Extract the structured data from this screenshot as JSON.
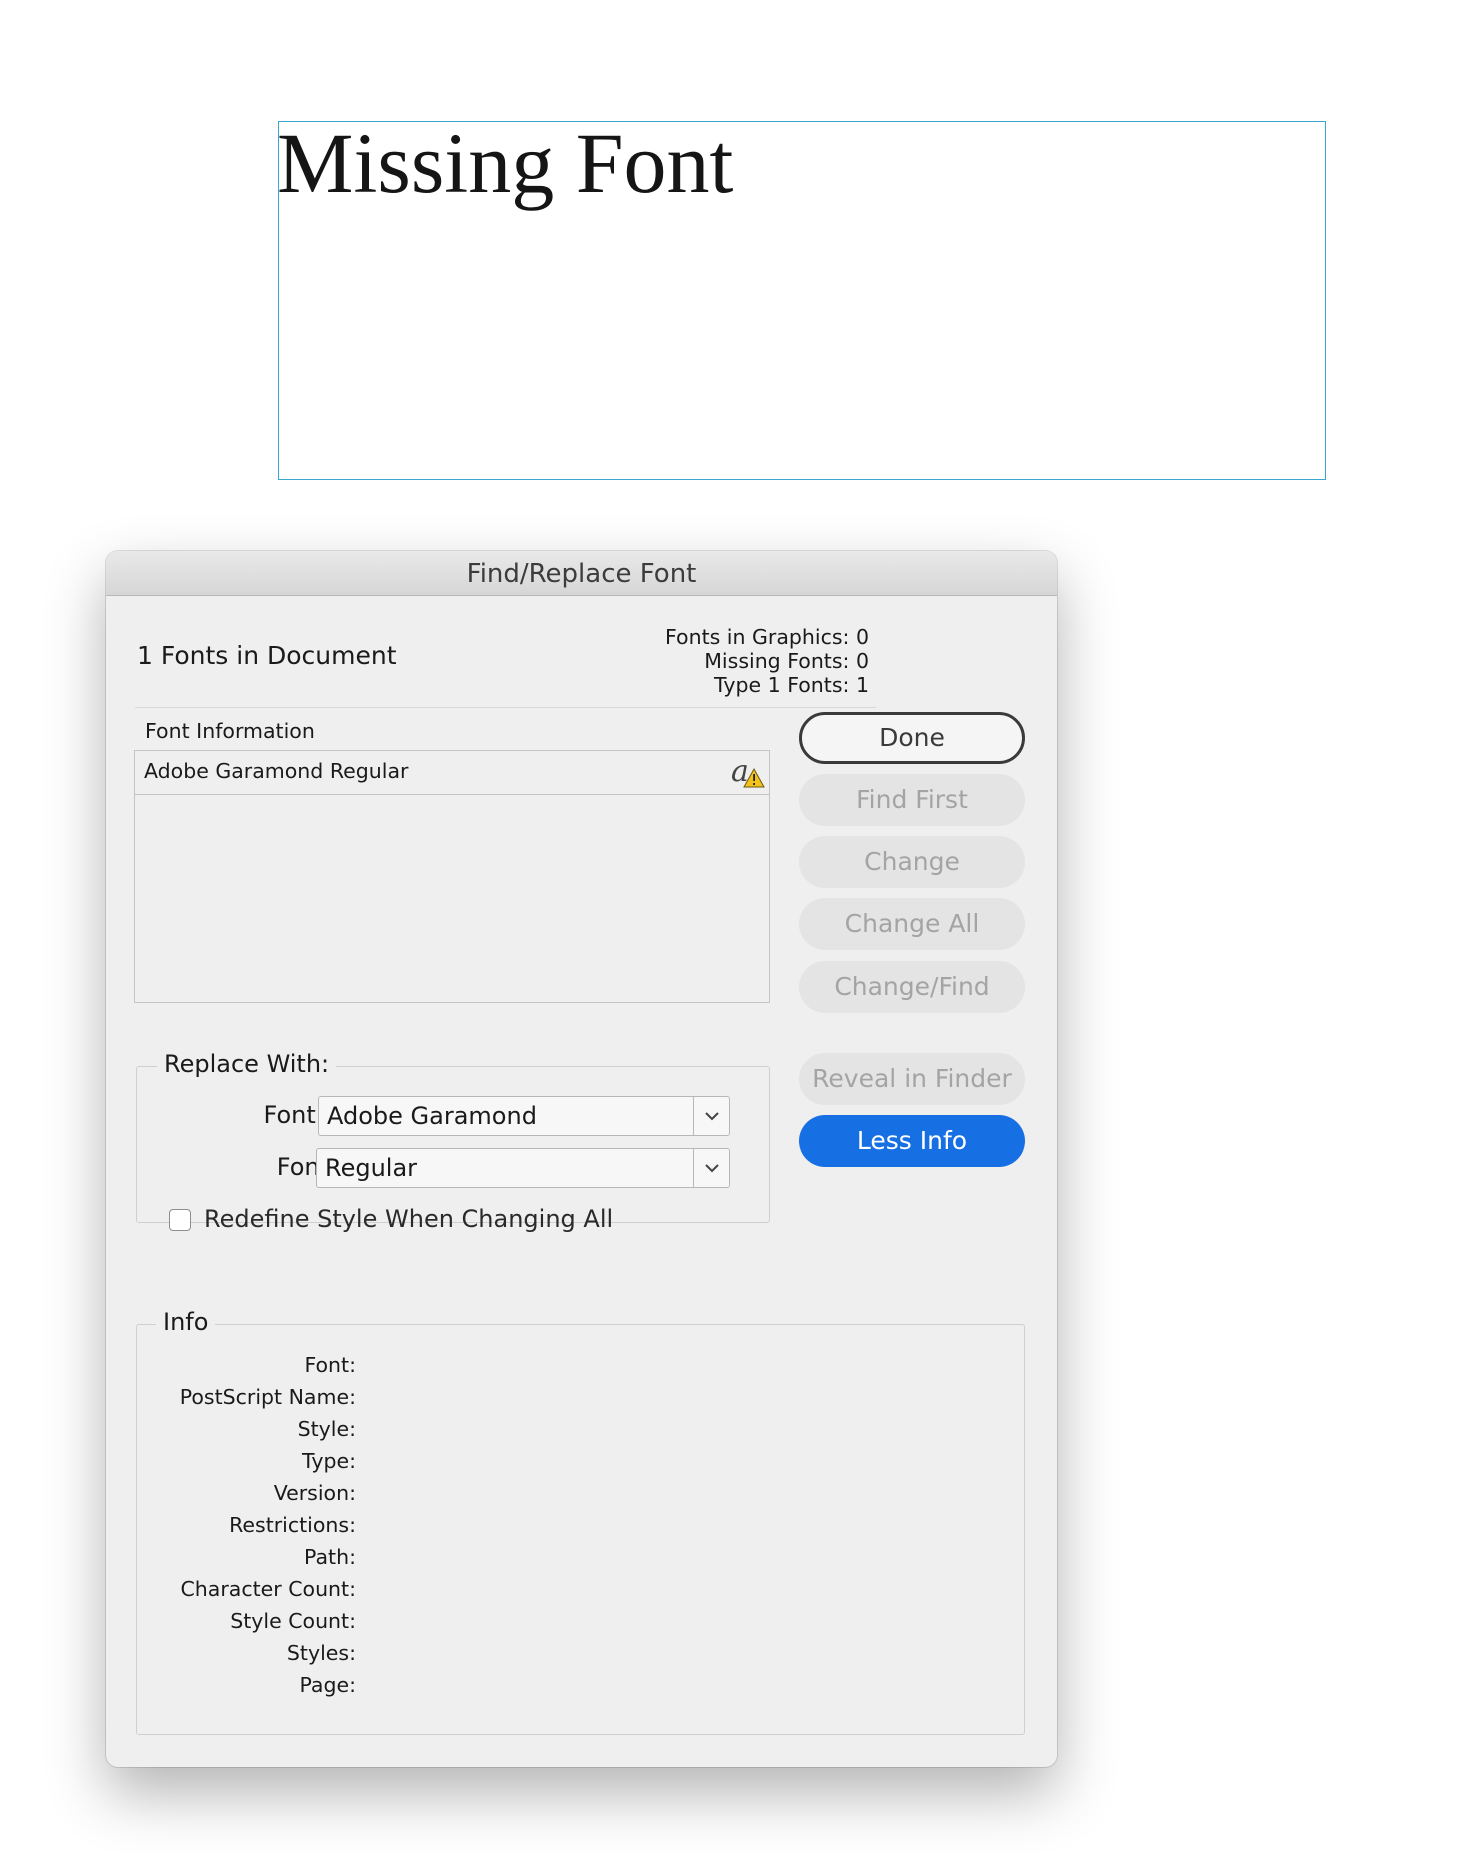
{
  "document": {
    "frame_text": "Missing Font"
  },
  "dialog": {
    "title": "Find/Replace Font",
    "fonts_in_document": "1 Fonts in Document",
    "stats": {
      "fonts_in_graphics": "Fonts in Graphics: 0",
      "missing_fonts": "Missing Fonts: 0",
      "type1_fonts": "Type 1 Fonts: 1"
    },
    "font_information_label": "Font Information",
    "font_list": [
      {
        "name": "Adobe Garamond Regular",
        "icon": "type1-font-warning-icon"
      }
    ],
    "buttons": {
      "done": "Done",
      "find_first": "Find First",
      "change": "Change",
      "change_all": "Change All",
      "change_find": "Change/Find",
      "reveal_in_finder": "Reveal in Finder",
      "less_info": "Less Info"
    },
    "replace_with": {
      "title": "Replace With:",
      "font_family_label": "Font Family:",
      "font_family_value": "Adobe Garamond",
      "font_style_label": "Font Style:",
      "font_style_value": "Regular",
      "redefine_label": "Redefine Style When Changing All",
      "redefine_checked": false
    },
    "info": {
      "title": "Info",
      "fields": [
        "Font:",
        "PostScript Name:",
        "Style:",
        "Type:",
        "Version:",
        "Restrictions:",
        "Path:",
        "Character Count:",
        "Style Count:",
        "Styles:",
        "Page:"
      ]
    },
    "colors": {
      "primary_button": "#1670e4",
      "frame_border": "#3ba7cf",
      "warning": "#f2c21b"
    }
  }
}
